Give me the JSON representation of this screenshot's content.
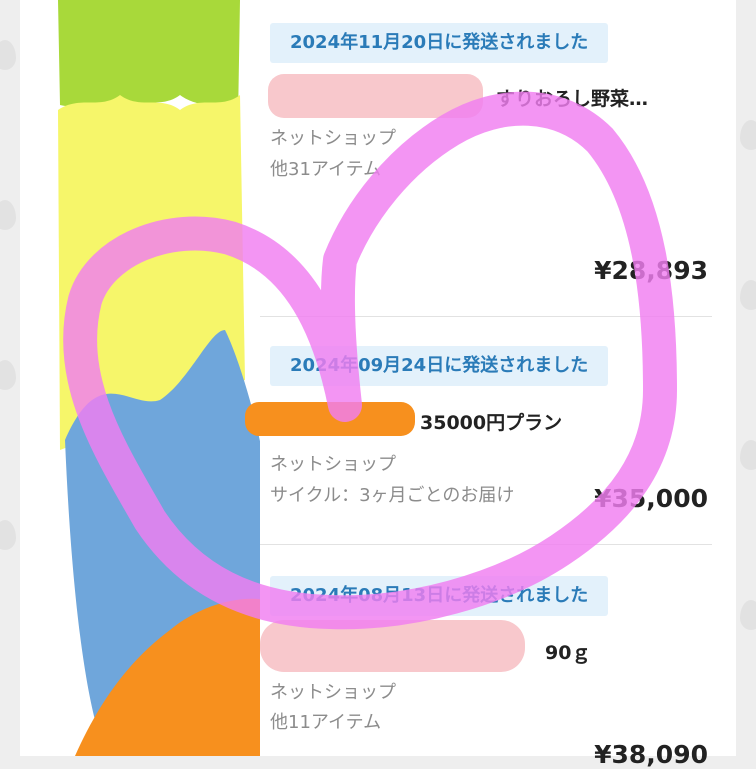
{
  "orders": [
    {
      "date_label": "2024年11月20日に発送されました",
      "product_name": "すりおろし野菜…",
      "shop": "ネットショップ",
      "sub_info": "他31アイテム",
      "price": "¥28,893"
    },
    {
      "date_label": "2024年09月24日に発送されました",
      "product_name": "35000円プラン",
      "shop": "ネットショップ",
      "sub_info": "サイクル：3ヶ月ごとのお届け",
      "price": "¥35,000"
    },
    {
      "date_label": "2024年08月13日に発送されました",
      "product_name": "90ｇ",
      "shop": "ネットショップ",
      "sub_info": "他11アイテム",
      "price": "¥38,090"
    }
  ],
  "colors": {
    "badge_bg": "#e3f1fb",
    "badge_text": "#2a7bb8",
    "thumb_green": "#a8d93a",
    "thumb_yellow": "#f6f66a",
    "thumb_blue": "#6fa6db",
    "thumb_orange": "#f7901e",
    "heart_pink": "#f07ef0",
    "redact_pink": "#f8c8cc",
    "redact_orange": "#f7901e"
  }
}
